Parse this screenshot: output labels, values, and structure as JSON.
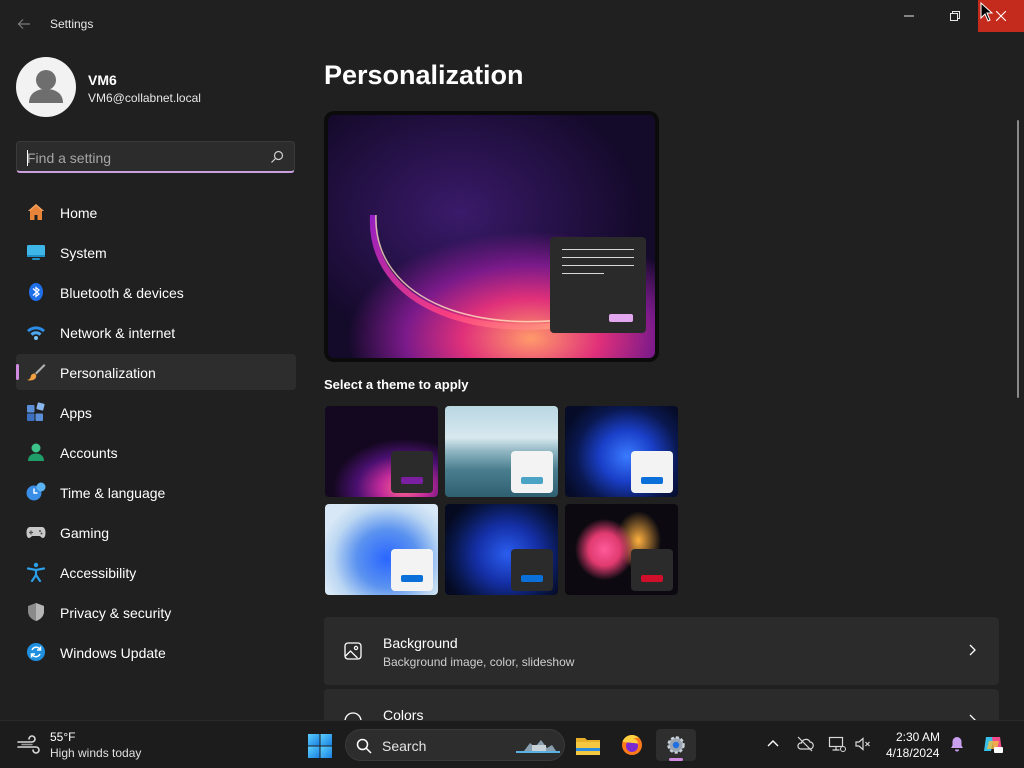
{
  "window": {
    "title": "Settings"
  },
  "profile": {
    "name": "VM6",
    "email": "VM6@collabnet.local"
  },
  "search": {
    "placeholder": "Find a setting"
  },
  "nav": {
    "items": [
      {
        "label": "Home",
        "icon": "home-icon"
      },
      {
        "label": "System",
        "icon": "system-icon"
      },
      {
        "label": "Bluetooth & devices",
        "icon": "bluetooth-icon"
      },
      {
        "label": "Network & internet",
        "icon": "network-icon"
      },
      {
        "label": "Personalization",
        "icon": "brush-icon",
        "selected": true
      },
      {
        "label": "Apps",
        "icon": "apps-icon"
      },
      {
        "label": "Accounts",
        "icon": "accounts-icon"
      },
      {
        "label": "Time & language",
        "icon": "time-language-icon"
      },
      {
        "label": "Gaming",
        "icon": "gaming-icon"
      },
      {
        "label": "Accessibility",
        "icon": "accessibility-icon"
      },
      {
        "label": "Privacy & security",
        "icon": "shield-icon"
      },
      {
        "label": "Windows Update",
        "icon": "windows-update-icon"
      }
    ]
  },
  "main": {
    "title": "Personalization",
    "theme_section_label": "Select a theme to apply",
    "themes": [
      {
        "name": "windows-dark-glow",
        "accent": "#7a1fa0"
      },
      {
        "name": "windows-spotlight",
        "accent": "#4aa3c4"
      },
      {
        "name": "windows-dark-bloom",
        "accent": "#0a6fd8"
      },
      {
        "name": "windows-light-bloom",
        "accent": "#0a6fd8"
      },
      {
        "name": "windows-dark-blue",
        "accent": "#0a6fd8"
      },
      {
        "name": "windows-flow",
        "accent": "#d0102a"
      }
    ],
    "cards": [
      {
        "title": "Background",
        "subtitle": "Background image, color, slideshow"
      },
      {
        "title": "Colors",
        "subtitle": ""
      }
    ]
  },
  "taskbar": {
    "weather_temp": "55°F",
    "weather_desc": "High winds today",
    "search_label": "Search",
    "clock_time": "2:30 AM",
    "clock_date": "4/18/2024"
  },
  "colors": {
    "accent": "#d08be0",
    "close": "#c42b1c",
    "background": "#202020"
  }
}
